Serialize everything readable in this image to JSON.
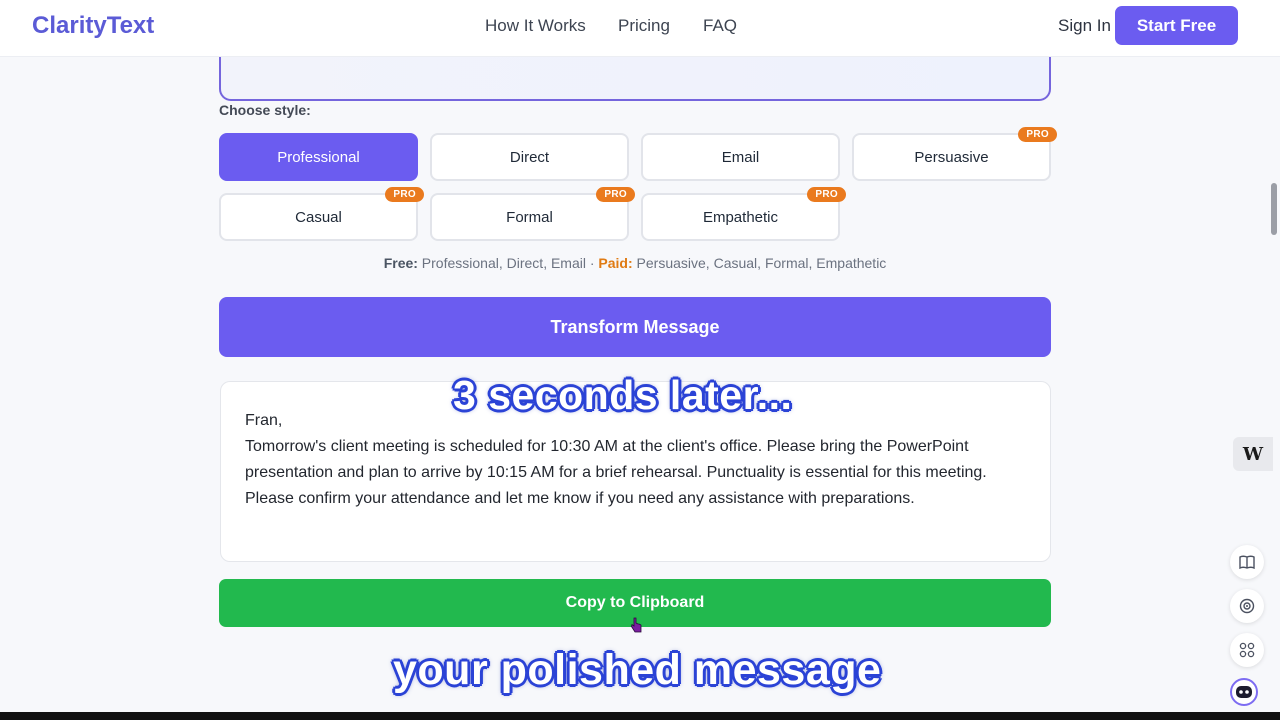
{
  "header": {
    "logo": "ClarityText",
    "nav": [
      "How It Works",
      "Pricing",
      "FAQ"
    ],
    "sign_in": "Sign In",
    "start_free": "Start Free"
  },
  "styles": {
    "label": "Choose style:",
    "pro_badge": "PRO",
    "options": [
      {
        "label": "Professional",
        "active": true,
        "pro": false
      },
      {
        "label": "Direct",
        "active": false,
        "pro": false
      },
      {
        "label": "Email",
        "active": false,
        "pro": false
      },
      {
        "label": "Persuasive",
        "active": false,
        "pro": true
      },
      {
        "label": "Casual",
        "active": false,
        "pro": true
      },
      {
        "label": "Formal",
        "active": false,
        "pro": true
      },
      {
        "label": "Empathetic",
        "active": false,
        "pro": true
      }
    ],
    "tier_note": {
      "free_label": "Free:",
      "free_list": " Professional, Direct, Email · ",
      "paid_label": "Paid:",
      "paid_list": " Persuasive, Casual, Formal, Empathetic"
    }
  },
  "transform_button": "Transform Message",
  "output": {
    "lines": [
      "Fran,",
      "Tomorrow's client meeting is scheduled for 10:30 AM at the client's office. Please bring the PowerPoint presentation and plan to arrive by 10:15 AM for a brief rehearsal. Punctuality is essential for this meeting.",
      "Please confirm your attendance and let me know if you need any assistance with preparations."
    ]
  },
  "copy_button": "Copy to Clipboard",
  "captions": {
    "top": "3 seconds later...",
    "bottom": "your polished message"
  },
  "widgets": {
    "w_logo": "W",
    "icons": [
      "book-icon",
      "signal-icon",
      "apps-icon",
      "assistant-icon"
    ]
  },
  "colors": {
    "brand": "#6b5cf0",
    "copy_green": "#22b94e",
    "pro_orange": "#ea7a1e"
  }
}
